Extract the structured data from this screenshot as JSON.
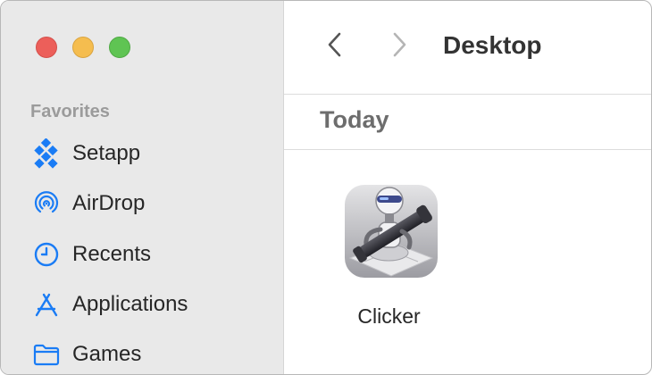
{
  "window": {
    "traffic_lights": {
      "close": "#ec5f5a",
      "minimize": "#f5bd4f",
      "zoom": "#5fc453"
    }
  },
  "sidebar": {
    "section_title": "Favorites",
    "items": [
      {
        "label": "Setapp",
        "icon": "setapp-icon"
      },
      {
        "label": "AirDrop",
        "icon": "airdrop-icon"
      },
      {
        "label": "Recents",
        "icon": "clock-icon"
      },
      {
        "label": "Applications",
        "icon": "applications-icon"
      },
      {
        "label": "Games",
        "icon": "folder-icon"
      }
    ],
    "accent_color": "#1a7cf5"
  },
  "toolbar": {
    "back_icon": "chevron-left-icon",
    "forward_icon": "chevron-right-icon",
    "title": "Desktop"
  },
  "content": {
    "group_label": "Today",
    "files": [
      {
        "name": "Clicker",
        "icon": "automator-robot-icon"
      }
    ]
  }
}
